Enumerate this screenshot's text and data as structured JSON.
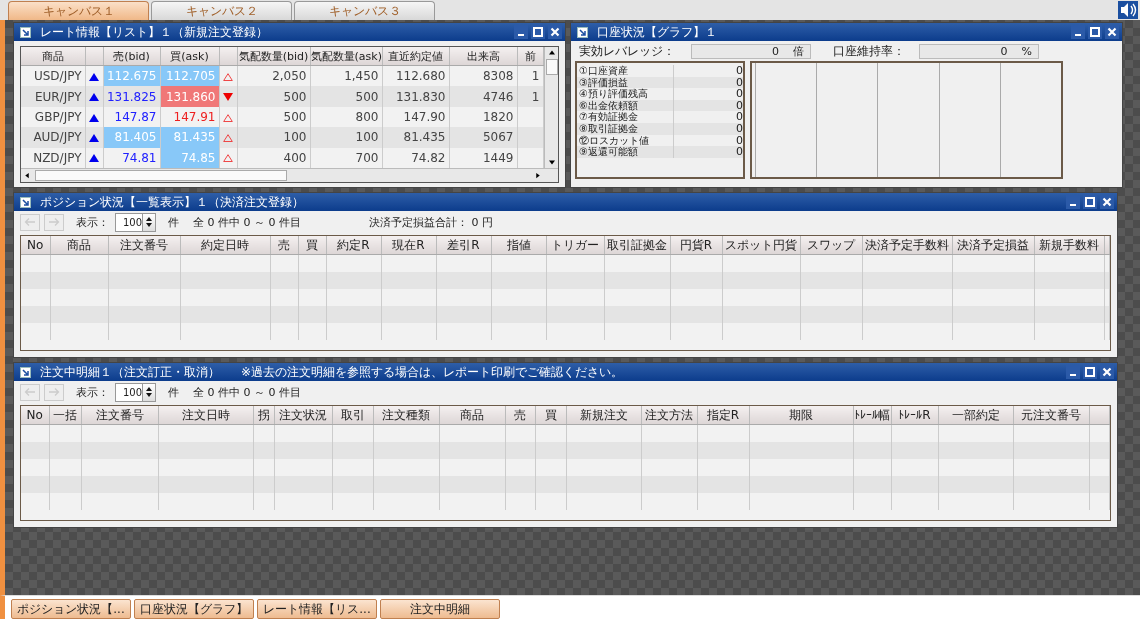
{
  "canvas_tabs": [
    {
      "label": "キャンバス１",
      "selected": true
    },
    {
      "label": "キャンバス２",
      "selected": false
    },
    {
      "label": "キャンバス３",
      "selected": false
    }
  ],
  "rate_panel": {
    "title": "レート情報【リスト】１（新規注文登録）",
    "columns": [
      "商品",
      "",
      "売(bid)",
      "買(ask)",
      "",
      "気配数量(bid)",
      "気配数量(ask)",
      "直近約定値",
      "出来高",
      "前"
    ],
    "rows": [
      {
        "symbol": "USD/JPY",
        "trend_up": true,
        "bid": "112.675",
        "bid_highlighted": true,
        "ask": "112.705",
        "ask_highlighted": true,
        "ask_falling": false,
        "change_up": true,
        "qty_bid": "2,050",
        "qty_ask": "1,450",
        "last": "112.680",
        "volume": "8308",
        "column_10": "1"
      },
      {
        "symbol": "EUR/JPY",
        "trend_up": true,
        "bid": "131.825",
        "bid_highlighted": false,
        "ask": "131.860",
        "ask_highlighted": true,
        "ask_falling": true,
        "change_up": false,
        "qty_bid": "500",
        "qty_ask": "500",
        "last": "131.830",
        "volume": "4746",
        "column_10": "1"
      },
      {
        "symbol": "GBP/JPY",
        "trend_up": true,
        "bid": "147.87",
        "bid_highlighted": false,
        "ask": "147.91",
        "ask_highlighted": false,
        "ask_falling": false,
        "change_up": true,
        "qty_bid": "500",
        "qty_ask": "800",
        "last": "147.90",
        "volume": "1820"
      },
      {
        "symbol": "AUD/JPY",
        "trend_up": true,
        "bid": "81.405",
        "bid_highlighted": true,
        "ask": "81.435",
        "ask_highlighted": true,
        "ask_falling": false,
        "change_up": true,
        "qty_bid": "100",
        "qty_ask": "100",
        "last": "81.435",
        "volume": "5067"
      },
      {
        "symbol": "NZD/JPY",
        "trend_up": true,
        "bid": "74.81",
        "bid_highlighted": false,
        "ask": "74.85",
        "ask_highlighted": true,
        "ask_falling": false,
        "change_up": true,
        "qty_bid": "400",
        "qty_ask": "700",
        "last": "74.82",
        "volume": "1449"
      }
    ]
  },
  "account_panel": {
    "title": "口座状況【グラフ】１",
    "leverage": {
      "label": "実効レバレッジ：",
      "value": "0",
      "unit": "倍"
    },
    "maintenance": {
      "label": "口座維持率：",
      "value": "0",
      "unit": "%"
    },
    "items": [
      {
        "label": "①口座資産",
        "value": "0"
      },
      {
        "label": "③評価損益",
        "value": "0"
      },
      {
        "label": "④預り評価残高",
        "value": "0"
      },
      {
        "label": "⑥出金依頼額",
        "value": "0"
      },
      {
        "label": "⑦有効証拠金",
        "value": "0"
      },
      {
        "label": "⑧取引証拠金",
        "value": "0"
      },
      {
        "label": "⑫ロスカット値",
        "value": "0"
      },
      {
        "label": "⑨返還可能額",
        "value": "0"
      }
    ]
  },
  "position_panel": {
    "title": "ポジション状況【一覧表示】１（決済注文登録）",
    "display_label": "表示：",
    "page_size": "100",
    "unit": "件",
    "range": "全 0 件中 0 ～ 0 件目",
    "total": "決済予定損益合計： 0 円",
    "columns": [
      "No",
      "商品",
      "注文番号",
      "約定日時",
      "売",
      "買",
      "約定R",
      "現在R",
      "差引R",
      "指値",
      "トリガー",
      "取引証拠金",
      "円貨R",
      "スポット円貨",
      "スワップ",
      "決済予定手数料",
      "決済予定損益",
      "新規手数料"
    ]
  },
  "order_panel": {
    "title": "注文中明細１（注文訂正・取消）",
    "notice": "※過去の注文明細を参照する場合は、レポート印刷でご確認ください。",
    "display_label": "表示：",
    "page_size": "100",
    "unit": "件",
    "range": "全 0 件中 0 ～ 0 件目",
    "columns": [
      "No",
      "一括",
      "注文番号",
      "注文日時",
      "拐",
      "注文状況",
      "取引",
      "注文種類",
      "商品",
      "売",
      "買",
      "新規注文",
      "注文方法",
      "指定R",
      "期限",
      "ﾄﾚｰﾙ幅",
      "ﾄﾚｰﾙR",
      "一部約定",
      "元注文番号"
    ]
  },
  "taskbar": [
    {
      "label": "ポジション状況【..."
    },
    {
      "label": "口座状況【グラフ】"
    },
    {
      "label": "レート情報【リス..."
    },
    {
      "label": "注文中明細"
    }
  ]
}
